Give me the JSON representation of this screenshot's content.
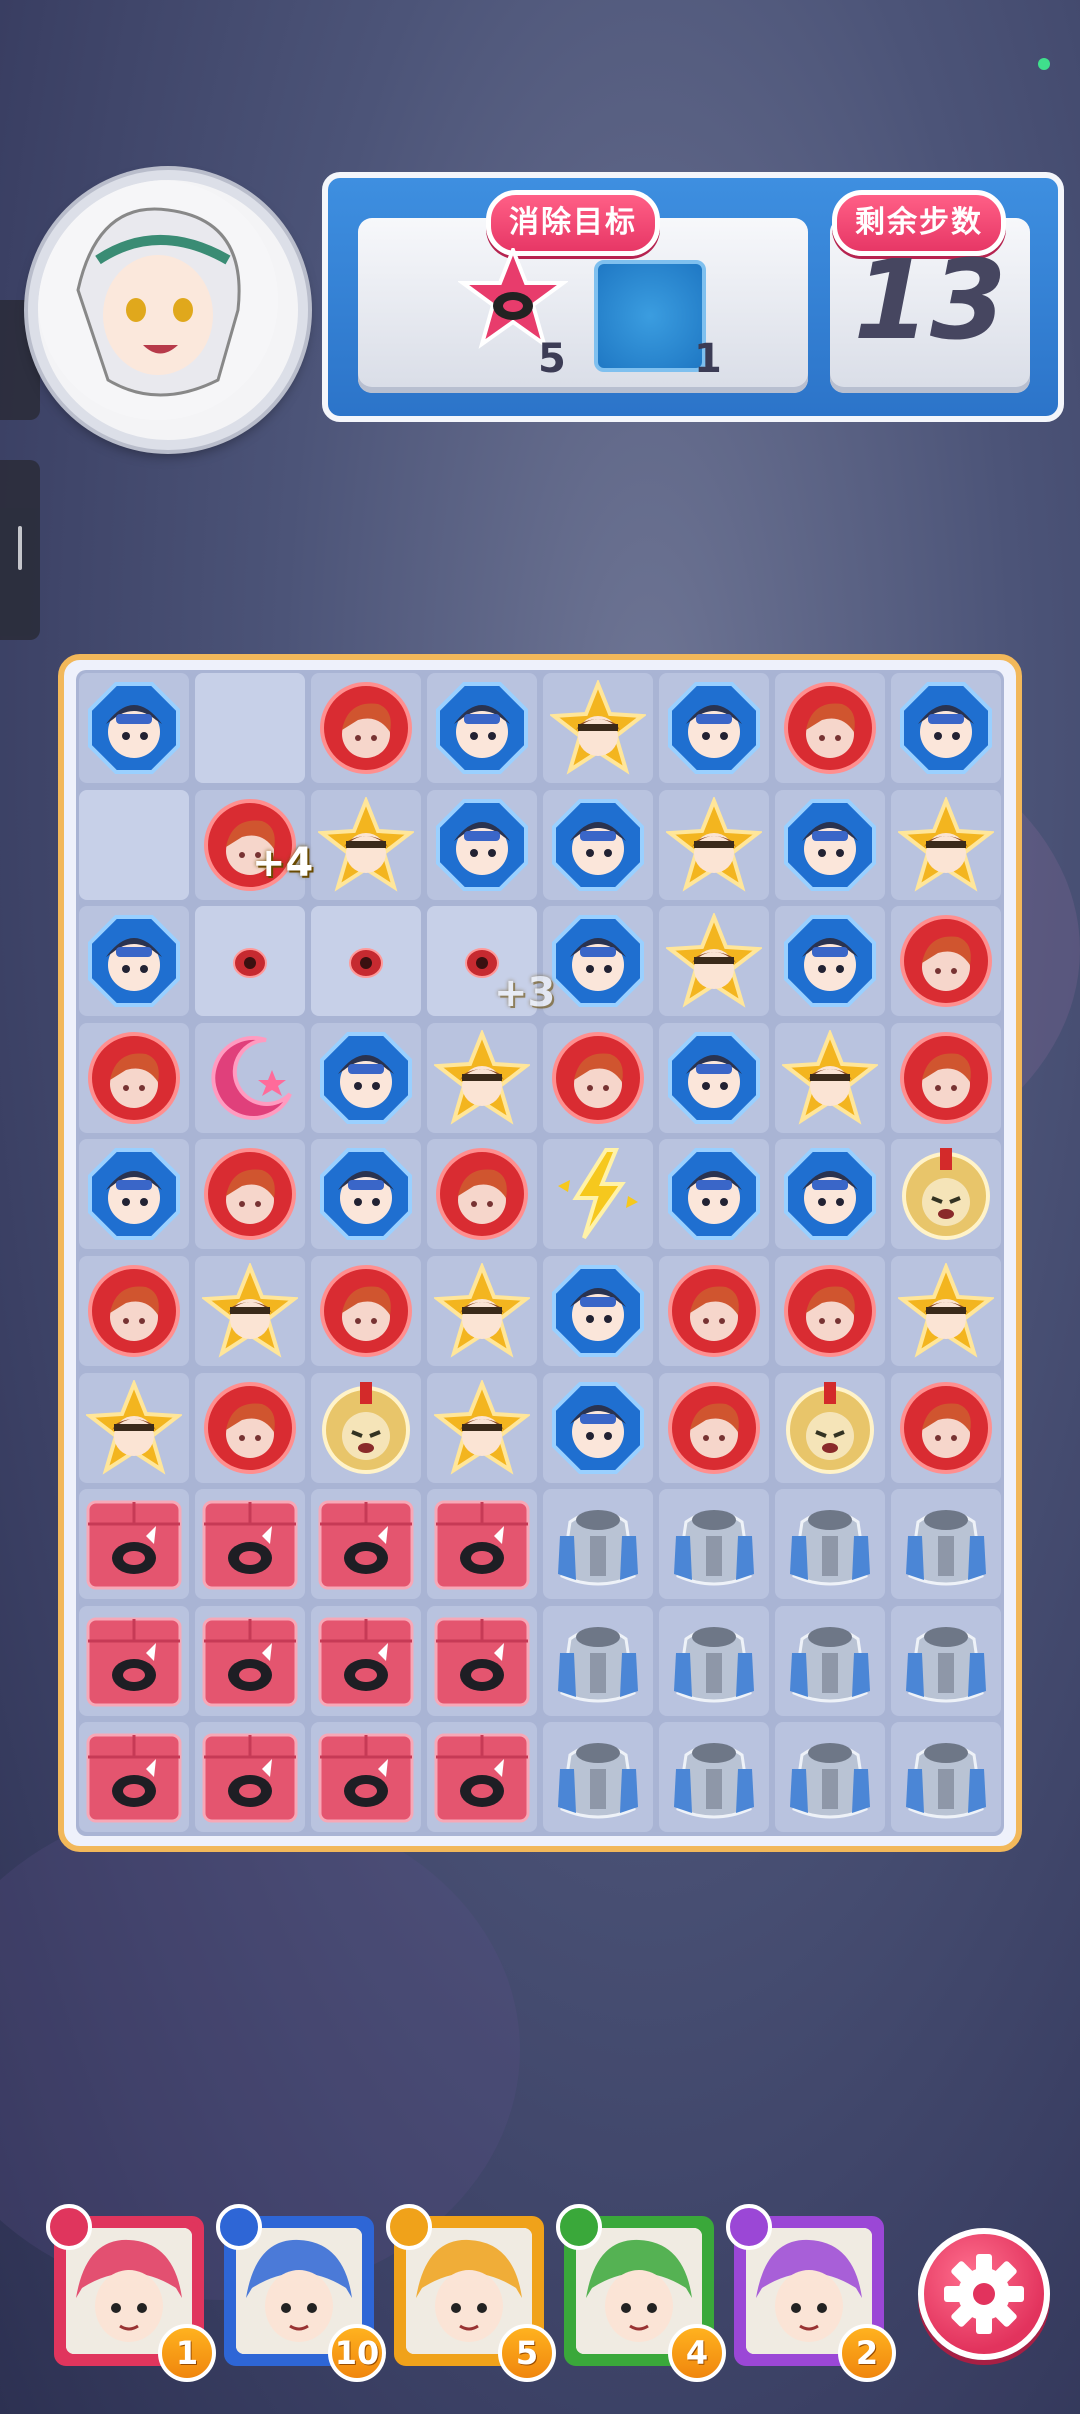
{
  "hud": {
    "goal_title": "消除目标",
    "steps_title": "剩余步数",
    "steps_remaining": "13",
    "goals": [
      {
        "icon": "pink-box-blocker-icon",
        "count": "5"
      },
      {
        "icon": "blue-ice-tile-icon",
        "count": "1"
      }
    ]
  },
  "board": {
    "popups": [
      "+4",
      "+3"
    ],
    "legend": {
      "B": "blue-octagon-gem",
      "R": "red-circle-gem",
      "Y": "yellow-star-gem",
      "G": "gold-helmet-gem",
      "M": "pink-moon-gem",
      "L": "lightning-special",
      "P": "pink-box-blocker",
      "S": "silver-robot-blocker",
      "s": "small-red-orb",
      "_": "empty"
    },
    "rows": [
      [
        "B",
        "_",
        "R",
        "B",
        "Y",
        "B",
        "R",
        "B"
      ],
      [
        "_",
        "R",
        "Y",
        "B",
        "B",
        "Y",
        "B",
        "Y"
      ],
      [
        "B",
        "s",
        "s",
        "s",
        "B",
        "Y",
        "B",
        "R"
      ],
      [
        "R",
        "M",
        "B",
        "Y",
        "R",
        "B",
        "Y",
        "R"
      ],
      [
        "B",
        "R",
        "B",
        "R",
        "L",
        "B",
        "B",
        "G"
      ],
      [
        "R",
        "Y",
        "R",
        "Y",
        "B",
        "R",
        "R",
        "Y"
      ],
      [
        "Y",
        "R",
        "G",
        "Y",
        "B",
        "R",
        "G",
        "R"
      ],
      [
        "P",
        "P",
        "P",
        "P",
        "S",
        "S",
        "S",
        "S"
      ],
      [
        "P",
        "P",
        "P",
        "P",
        "S",
        "S",
        "S",
        "S"
      ],
      [
        "P",
        "P",
        "P",
        "P",
        "S",
        "S",
        "S",
        "S"
      ]
    ]
  },
  "characters": [
    {
      "name": "hero-1",
      "count": "1",
      "frame": "#e0355d",
      "icon_color": "#e0355d",
      "skill": "cross-icon"
    },
    {
      "name": "hero-2",
      "count": "10",
      "frame": "#2e66d6",
      "icon_color": "#2e66d6",
      "skill": "horizontal-arrows-icon"
    },
    {
      "name": "hero-3",
      "count": "5",
      "frame": "#f0a21a",
      "icon_color": "#f0a21a",
      "skill": "vertical-arrows-icon"
    },
    {
      "name": "hero-4",
      "count": "4",
      "frame": "#3aa83a",
      "icon_color": "#3aa83a",
      "skill": "swap-icon"
    },
    {
      "name": "hero-5",
      "count": "2",
      "frame": "#9b47d6",
      "icon_color": "#9b47d6",
      "skill": "brush-icon"
    }
  ],
  "colors": {
    "accent_pink": "#e73766",
    "hud_blue": "#2c74c9",
    "board_border": "#f2b85a"
  }
}
